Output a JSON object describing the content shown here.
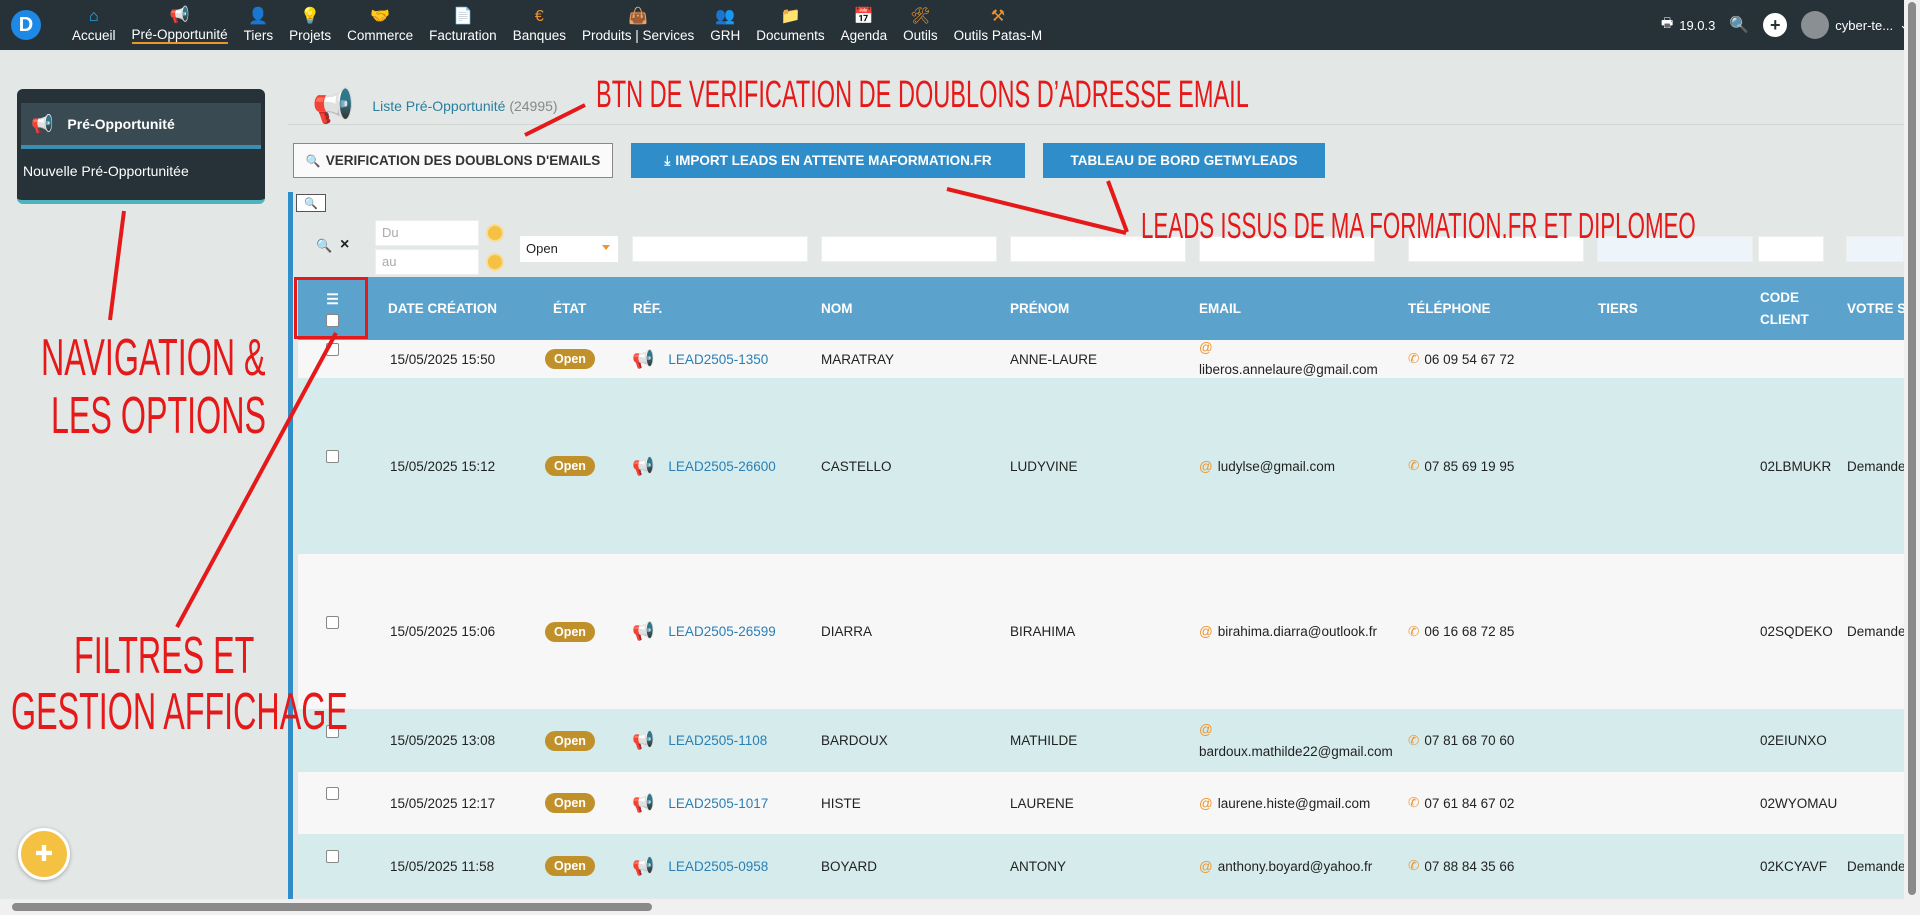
{
  "menu": [
    {
      "label": "Accueil",
      "icon": "home-icon",
      "glyph": "⌂"
    },
    {
      "label": "Pré-Opportunité",
      "icon": "megaphone-icon",
      "glyph": "📢"
    },
    {
      "label": "Tiers",
      "icon": "user-plus-icon",
      "glyph": "👤"
    },
    {
      "label": "Projets",
      "icon": "lightbulb-icon",
      "glyph": "💡"
    },
    {
      "label": "Commerce",
      "icon": "handshake-icon",
      "glyph": "🤝"
    },
    {
      "label": "Facturation",
      "icon": "invoice-icon",
      "glyph": "📄"
    },
    {
      "label": "Banques",
      "icon": "euro-icon",
      "glyph": "€"
    },
    {
      "label": "Produits | Services",
      "icon": "shopping-bag-icon",
      "glyph": "👜"
    },
    {
      "label": "GRH",
      "icon": "users-icon",
      "glyph": "👥"
    },
    {
      "label": "Documents",
      "icon": "folder-icon",
      "glyph": "📁"
    },
    {
      "label": "Agenda",
      "icon": "calendar-icon",
      "glyph": "📅"
    },
    {
      "label": "Outils",
      "icon": "tools-icon",
      "glyph": "🛠"
    },
    {
      "label": "Outils Patas-M",
      "icon": "hammer-icon",
      "glyph": "⚒"
    }
  ],
  "topright": {
    "version": "19.0.3",
    "user": "cyber-te..."
  },
  "sidebar": {
    "title": "Pré-Opportunité",
    "new_item": "Nouvelle Pré-Opportunitée"
  },
  "page": {
    "title": "Liste Pré-Opportunité",
    "count": "(24995)"
  },
  "buttons": {
    "verif": "VERIFICATION DES DOUBLONS D'EMAILS",
    "import": "IMPORT LEADS EN ATTENTE MAFORMATION.FR",
    "dashboard": "TABLEAU DE BORD GETMYLEADS"
  },
  "annotations": {
    "verif": "BTN DE VERIFICATION DE DOUBLONS D’ADRESSE EMAIL",
    "leads": "LEADS ISSUS DE MA FORMATION.FR ET DIPLOMEO",
    "nav1": "NAVIGATION &",
    "nav2": "LES OPTIONS",
    "filt1": "FILTRES ET",
    "filt2": "GESTION AFFICHAGE"
  },
  "filters": {
    "du": "Du",
    "au": "au",
    "state": "Open"
  },
  "columns": {
    "date": "DATE CRÉATION",
    "etat": "ÉTAT",
    "ref": "RÉF.",
    "nom": "NOM",
    "prenom": "PRÉNOM",
    "email": "EMAIL",
    "tel": "TÉLÉPHONE",
    "tiers": "TIERS",
    "code1": "CODE",
    "code2": "CLIENT",
    "votre": "VOTRE S"
  },
  "rows": [
    {
      "date": "15/05/2025 15:50",
      "etat": "Open",
      "ref": "LEAD2505-1350",
      "nom": "MARATRAY",
      "prenom": "ANNE-LAURE",
      "email": "liberos.annelaure@gmail.com",
      "tel": "06 09 54 67 72",
      "code": "",
      "votre": ""
    },
    {
      "date": "15/05/2025 15:12",
      "etat": "Open",
      "ref": "LEAD2505-26600",
      "nom": "CASTELLO",
      "prenom": "LUDYVINE",
      "email": "ludylse@gmail.com",
      "tel": "07 85 69 19 95",
      "code": "02LBMUKR",
      "votre": "Demande"
    },
    {
      "date": "15/05/2025 15:06",
      "etat": "Open",
      "ref": "LEAD2505-26599",
      "nom": "DIARRA",
      "prenom": "BIRAHIMA",
      "email": "birahima.diarra@outlook.fr",
      "tel": "06 16 68 72 85",
      "code": "02SQDEKO",
      "votre": "Demande"
    },
    {
      "date": "15/05/2025 13:08",
      "etat": "Open",
      "ref": "LEAD2505-1108",
      "nom": "BARDOUX",
      "prenom": "MATHILDE",
      "email": "bardoux.mathilde22@gmail.com",
      "tel": "07 81 68 70 60",
      "code": "02EIUNXO",
      "votre": ""
    },
    {
      "date": "15/05/2025 12:17",
      "etat": "Open",
      "ref": "LEAD2505-1017",
      "nom": "HISTE",
      "prenom": "LAURENE",
      "email": "laurene.histe@gmail.com",
      "tel": "07 61 84 67 02",
      "code": "02WYOMAU",
      "votre": ""
    },
    {
      "date": "15/05/2025 11:58",
      "etat": "Open",
      "ref": "LEAD2505-0958",
      "nom": "BOYARD",
      "prenom": "ANTONY",
      "email": "anthony.boyard@yahoo.fr",
      "tel": "07 88 84 35 66",
      "code": "02KCYAVF",
      "votre": "Demande"
    }
  ]
}
